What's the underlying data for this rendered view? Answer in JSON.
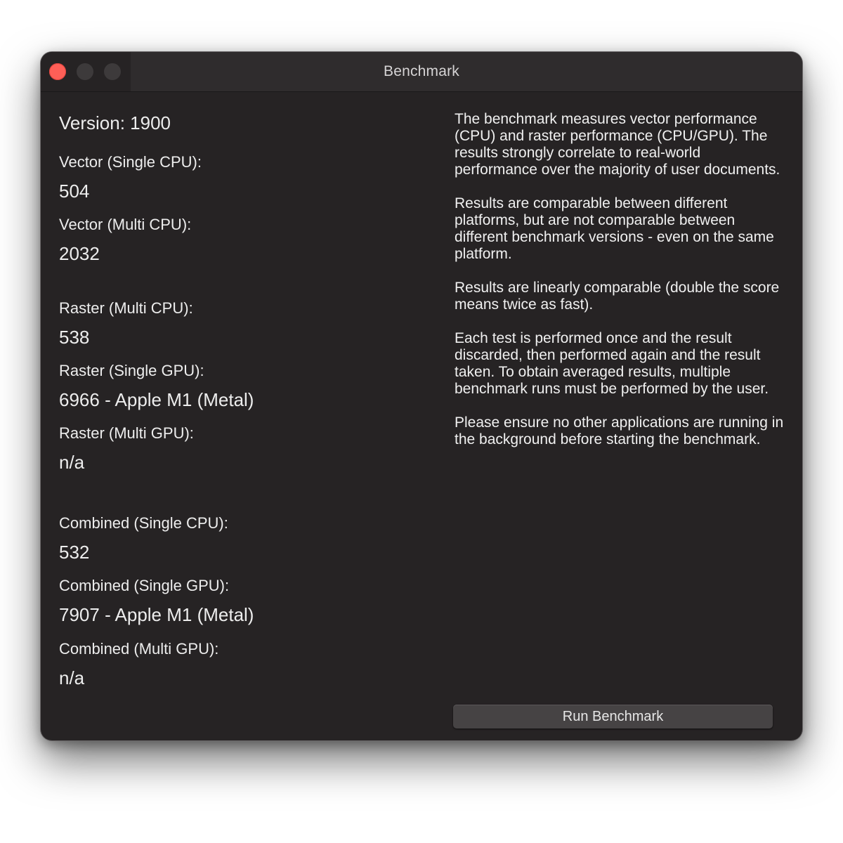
{
  "window": {
    "title": "Benchmark"
  },
  "titlebar": {
    "buttons": [
      "close-button",
      "minimize-button",
      "zoom-button"
    ],
    "colors": {
      "close": "#fe5f57",
      "inactive": "#3d3a3b"
    }
  },
  "results": {
    "version": "Version: 1900",
    "vector_single_cpu": {
      "label": "Vector (Single CPU):",
      "value": "504"
    },
    "vector_multi_cpu": {
      "label": "Vector (Multi CPU):",
      "value": "2032"
    },
    "raster_multi_cpu": {
      "label": "Raster (Multi CPU):",
      "value": "538"
    },
    "raster_single_gpu": {
      "label": "Raster (Single GPU):",
      "value": "6966 - Apple M1 (Metal)"
    },
    "raster_multi_gpu": {
      "label": "Raster (Multi GPU):",
      "value": "n/a"
    },
    "combined_single_cpu": {
      "label": "Combined (Single CPU):",
      "value": "532"
    },
    "combined_single_gpu": {
      "label": "Combined (Single GPU):",
      "value": "7907 - Apple M1 (Metal)"
    },
    "combined_multi_gpu": {
      "label": "Combined (Multi GPU):",
      "value": "n/a"
    }
  },
  "description": {
    "paragraphs": [
      "The benchmark measures vector performance (CPU) and raster performance (CPU/GPU). The results strongly correlate to real-world performance over the majority of user documents.",
      "Results are comparable between different platforms, but are not comparable between different benchmark versions - even on the same platform.",
      "Results are linearly comparable (double the score means twice as fast).",
      "Each test is performed once and the result discarded, then performed again and the result taken. To obtain averaged results, multiple benchmark runs must be performed by the user.",
      "Please ensure no other applications are running in the background before starting the benchmark."
    ]
  },
  "actions": {
    "run_label": "Run Benchmark"
  }
}
